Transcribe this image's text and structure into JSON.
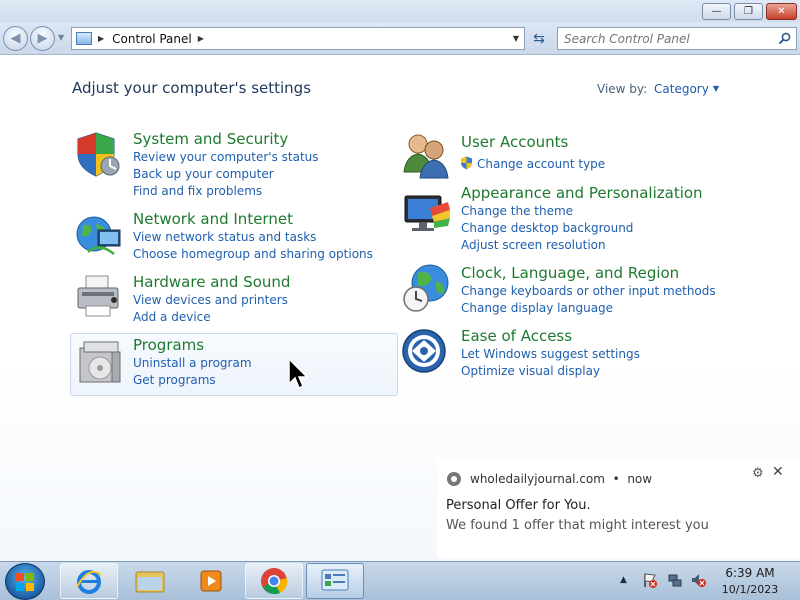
{
  "address": {
    "location": "Control Panel"
  },
  "search": {
    "placeholder": "Search Control Panel"
  },
  "page": {
    "title": "Adjust your computer's settings",
    "view_by_label": "View by:",
    "view_by_value": "Category"
  },
  "categories": [
    {
      "title": "System and Security",
      "links": [
        "Review your computer's status",
        "Back up your computer",
        "Find and fix problems"
      ]
    },
    {
      "title": "Network and Internet",
      "links": [
        "View network status and tasks",
        "Choose homegroup and sharing options"
      ]
    },
    {
      "title": "Hardware and Sound",
      "links": [
        "View devices and printers",
        "Add a device"
      ]
    },
    {
      "title": "Programs",
      "links": [
        "Uninstall a program",
        "Get programs"
      ]
    },
    {
      "title": "User Accounts",
      "links": [
        "Change account type"
      ]
    },
    {
      "title": "Appearance and Personalization",
      "links": [
        "Change the theme",
        "Change desktop background",
        "Adjust screen resolution"
      ]
    },
    {
      "title": "Clock, Language, and Region",
      "links": [
        "Change keyboards or other input methods",
        "Change display language"
      ]
    },
    {
      "title": "Ease of Access",
      "links": [
        "Let Windows suggest settings",
        "Optimize visual display"
      ]
    }
  ],
  "notification": {
    "source": "wholedailyjournal.com",
    "time": "now",
    "separator": "•",
    "title": "Personal Offer for You.",
    "body": "We found 1 offer that might interest you"
  },
  "taskbar": {
    "time": "6:39 AM",
    "date": "10/1/2023",
    "items": [
      "internet-explorer",
      "windows-explorer",
      "media-player",
      "chrome",
      "control-panel"
    ]
  },
  "colors": {
    "category_title": "#1e7a2f",
    "link": "#1f5fae",
    "page_title": "#1e395b"
  }
}
